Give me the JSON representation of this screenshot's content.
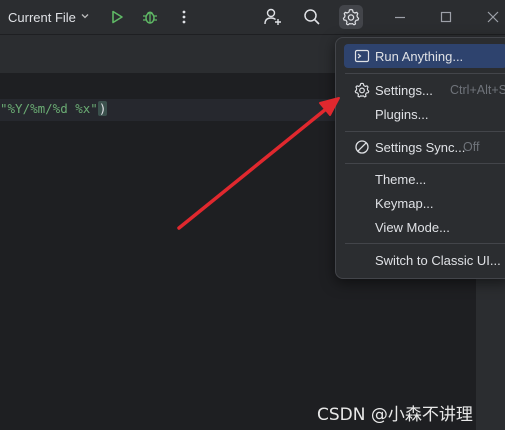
{
  "toolbar": {
    "run_config_label": "Current File",
    "icons": [
      "chevron-down-icon",
      "run-icon",
      "debug-icon",
      "more-vertical-icon",
      "add-user-icon",
      "search-icon",
      "gear-icon",
      "minimize-icon",
      "maximize-icon",
      "close-icon"
    ],
    "colors": {
      "run": "#5fb865",
      "debug": "#5fb865",
      "toolbar_bg": "#2b2d30"
    }
  },
  "editor": {
    "code_string": "\"%Y/%m/%d %x\"",
    "code_paren": ")",
    "colors": {
      "string": "#6aab73",
      "background": "#1e1f22"
    }
  },
  "menu": {
    "items": [
      {
        "label": "Run Anything...",
        "icon": "terminal-icon",
        "selected": true
      },
      {
        "label": "Settings...",
        "icon": "gear-icon",
        "shortcut": "Ctrl+Alt+S"
      },
      {
        "label": "Plugins..."
      },
      {
        "label": "Settings Sync...",
        "icon": "disabled-icon",
        "status": "Off"
      },
      {
        "label": "Theme..."
      },
      {
        "label": "Keymap..."
      },
      {
        "label": "View Mode..."
      },
      {
        "label": "Switch to Classic UI..."
      }
    ],
    "colors": {
      "selected": "#2e436e",
      "background": "#2b2d30"
    }
  },
  "annotation": {
    "arrow_color": "#e0282e"
  },
  "watermark": "CSDN @小森不讲理"
}
